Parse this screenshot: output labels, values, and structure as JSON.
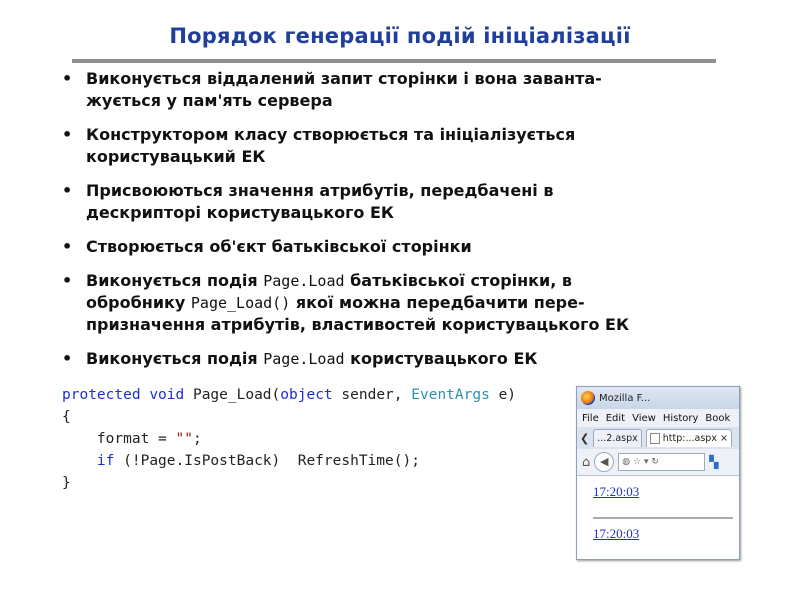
{
  "slide": {
    "title": "Порядок генерації подій ініціалізації",
    "bullets": [
      {
        "line1": "Виконується віддалений запит сторінки і вона заванта-",
        "line2": "жується у пам'ять сервера"
      },
      {
        "line1": "Конструктором класу створюється та ініціалізується",
        "line2": "користувацький ЕК"
      },
      {
        "line1": "Присвоюються значення атрибутів, передбачені в",
        "line2": "дескрипторі користувацького ЕК"
      },
      {
        "line1": "Створюється об'єкт батьківської сторінки"
      },
      {
        "p1": "Виконується подія ",
        "code1": "Page.Load",
        "p2": " батьківської сторінки, в",
        "p3": "обробнику ",
        "code2": "Page_Load()",
        "p4": " якої можна передбачити пере-",
        "p5": "призначення атрибутів, властивостей користувацького ЕК"
      },
      {
        "p1": "Виконується подія ",
        "code1": "Page.Load",
        "p2": " користувацького ЕК"
      }
    ]
  },
  "code": {
    "kw_protected": "protected",
    "kw_void": "void",
    "method": "Page_Load(",
    "kw_object": "object",
    "param1": "sender,",
    "type_eventargs": "EventArgs",
    "param2": "e)",
    "open_brace": "{",
    "assign": "format = ",
    "string_literal": "\"\"",
    "semicolon": ";",
    "kw_if": "if",
    "condition": "(!Page.IsPostBack)  RefreshTime();",
    "close_brace": "}"
  },
  "browser": {
    "window_title": "Mozilla F...",
    "menu": [
      "File",
      "Edit",
      "View",
      "History",
      "Book"
    ],
    "tabs": [
      {
        "label": "...2.aspx"
      },
      {
        "label": "http:...aspx",
        "close": "×"
      }
    ],
    "times": [
      "17:20:03",
      "17:20:03"
    ]
  }
}
